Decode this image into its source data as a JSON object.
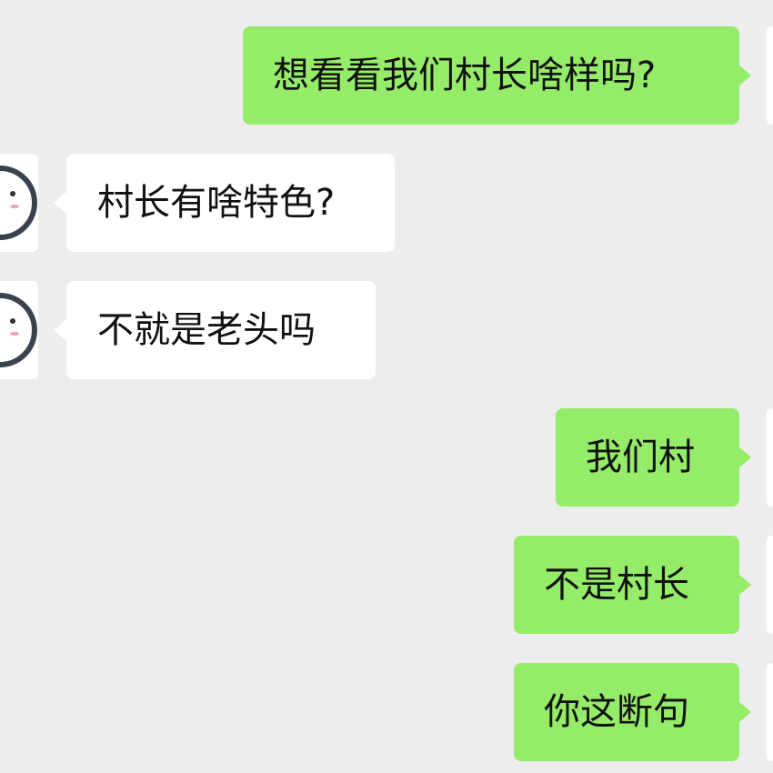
{
  "colors": {
    "background": "#ededed",
    "sent_bubble": "#95ec69",
    "received_bubble": "#ffffff",
    "text": "#111111"
  },
  "messages": [
    {
      "side": "sent",
      "text": "想看看我们村长啥样吗?"
    },
    {
      "side": "received",
      "text": "村长有啥特色?",
      "avatar": "face-avatar-icon"
    },
    {
      "side": "received",
      "text": "不就是老头吗",
      "avatar": "face-avatar-icon"
    },
    {
      "side": "sent",
      "text": "我们村"
    },
    {
      "side": "sent",
      "text": "不是村长"
    },
    {
      "side": "sent",
      "text": "你这断句"
    }
  ]
}
